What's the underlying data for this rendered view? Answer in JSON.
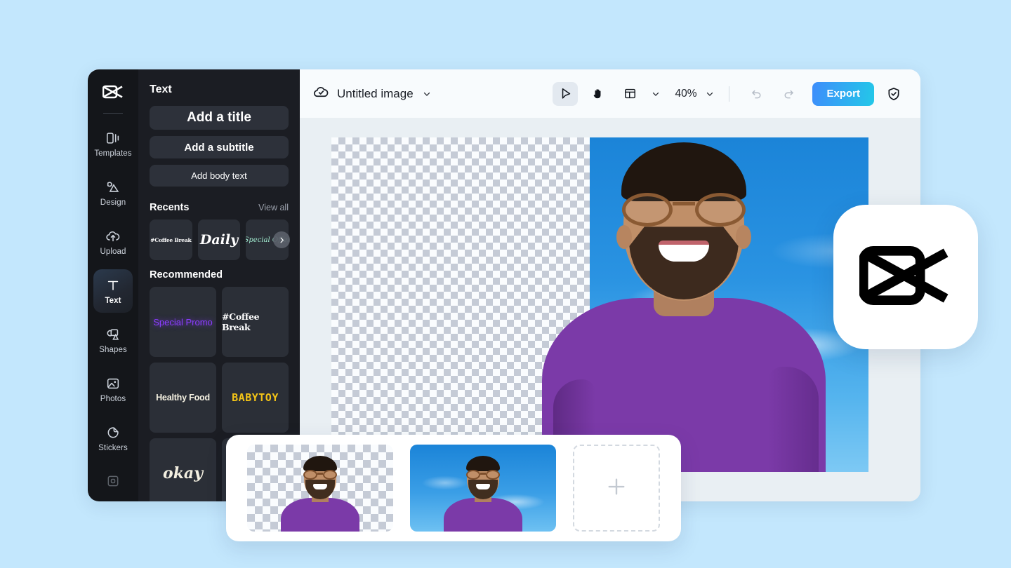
{
  "app": {
    "name": "CapCut",
    "background_color": "#c3e7fd"
  },
  "rail": {
    "logo_icon": "capcut-logo-icon",
    "items": [
      {
        "label": "Templates",
        "icon": "templates-icon",
        "active": false
      },
      {
        "label": "Design",
        "icon": "design-icon",
        "active": false
      },
      {
        "label": "Upload",
        "icon": "upload-cloud-icon",
        "active": false
      },
      {
        "label": "Text",
        "icon": "text-t-icon",
        "active": true
      },
      {
        "label": "Shapes",
        "icon": "shapes-icon",
        "active": false
      },
      {
        "label": "Photos",
        "icon": "photos-image-icon",
        "active": false
      },
      {
        "label": "Stickers",
        "icon": "stickers-icon",
        "active": false
      }
    ],
    "extra_icon": "frame-square-icon"
  },
  "panel": {
    "title": "Text",
    "buttons": [
      {
        "label": "Add a title"
      },
      {
        "label": "Add a subtitle"
      },
      {
        "label": "Add body text"
      }
    ],
    "recents": {
      "heading": "Recents",
      "view_all": "View all",
      "next_icon": "chevron-right-icon",
      "cards": [
        {
          "label": "#Coffee Break",
          "style": "serif-white"
        },
        {
          "label": "Daily",
          "style": "script-white"
        },
        {
          "label": "Special Offer",
          "style": "script-mint"
        }
      ]
    },
    "recommended": {
      "heading": "Recommended",
      "cards": [
        {
          "label": "Special Promo",
          "color": "#8b3dff"
        },
        {
          "label": "#Coffee Break",
          "color": "#ffffff"
        },
        {
          "label": "Healthy Food",
          "color": "#f6f2e2"
        },
        {
          "label": "BABYTOY",
          "color": "#f3c417"
        },
        {
          "label": "okay",
          "color": "#f3efe0"
        }
      ]
    }
  },
  "topbar": {
    "cloud_icon": "cloud-check-icon",
    "document_title": "Untitled image",
    "title_chevron_icon": "chevron-down-icon",
    "tools": [
      {
        "name": "select-cursor-icon",
        "selected": true
      },
      {
        "name": "hand-pan-icon",
        "selected": false
      },
      {
        "name": "layout-panels-icon",
        "selected": false
      }
    ],
    "layout_chevron_icon": "chevron-down-icon",
    "zoom_level": "40%",
    "zoom_chevron_icon": "chevron-down-icon",
    "undo_icon": "undo-arrow-icon",
    "redo_icon": "redo-arrow-icon",
    "export_label": "Export",
    "export_gradient": [
      "#3e8dfb",
      "#23c8e8"
    ],
    "shield_icon": "shield-check-icon"
  },
  "canvas": {
    "artboard_name": "image-artboard",
    "transparent_region_label": "transparent-checkerboard",
    "sky_region_label": "blue-sky-background",
    "subject_label": "smiling-man-photo"
  },
  "logo_badge": {
    "icon": "capcut-logo-icon"
  },
  "filmstrip": {
    "items": [
      {
        "name": "thumbnail-transparent-background",
        "selected": false
      },
      {
        "name": "thumbnail-blue-sky-background",
        "selected": false
      }
    ],
    "add_slot": {
      "icon": "plus-icon",
      "label": "+"
    }
  }
}
